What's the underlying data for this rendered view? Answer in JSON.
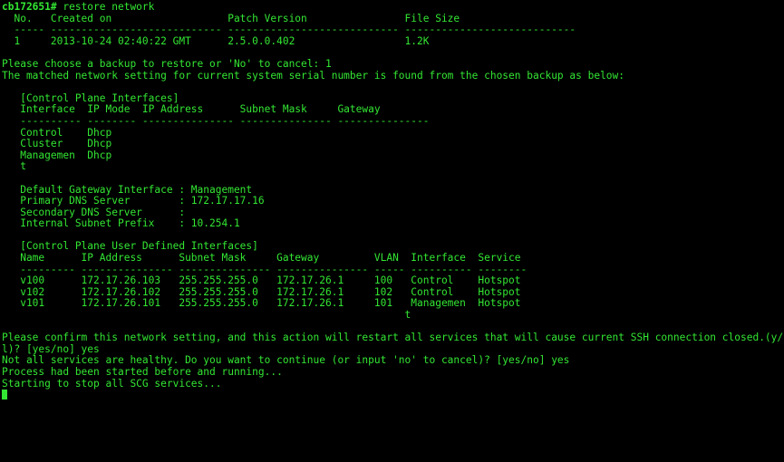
{
  "terminal": {
    "prompt": "cb172651#",
    "command": " restore network",
    "lines": [
      "  No.   Created on                   Patch Version                File Size",
      "  ----- ---------------------------- ---------------------------- ----------------------------",
      "  1     2013-10-24 02:40:22 GMT      2.5.0.0.402                  1.2K",
      "",
      "Please choose a backup to restore or 'No' to cancel: 1",
      "The matched network setting for current system serial number is found from the chosen backup as below:",
      "",
      "   [Control Plane Interfaces]",
      "   Interface  IP Mode  IP Address      Subnet Mask     Gateway",
      "   ---------- -------- --------------- --------------- ---------------",
      "   Control    Dhcp",
      "   Cluster    Dhcp",
      "   Managemen  Dhcp",
      "   t",
      "",
      "   Default Gateway Interface : Management",
      "   Primary DNS Server        : 172.17.17.16",
      "   Secondary DNS Server      :",
      "   Internal Subnet Prefix    : 10.254.1",
      "",
      "   [Control Plane User Defined Interfaces]",
      "   Name      IP Address      Subnet Mask     Gateway         VLAN  Interface  Service",
      "   --------- --------------- --------------- --------------- ----- ---------- --------",
      "   v100      172.17.26.103   255.255.255.0   172.17.26.1     100   Control    Hotspot",
      "   v102      172.17.26.102   255.255.255.0   172.17.26.1     102   Control    Hotspot",
      "   v101      172.17.26.101   255.255.255.0   172.17.26.1     101   Managemen  Hotspot",
      "                                                                  t",
      "",
      "Please confirm this network setting, and this action will restart all services that will cause current SSH connection closed.(y/n",
      "l)? [yes/no] yes",
      "Not all services are healthy. Do you want to continue (or input 'no' to cancel)? [yes/no] yes",
      "Process had been started before and running...",
      "Starting to stop all SCG services...",
      ""
    ]
  },
  "colors": {
    "background": "#000000",
    "text": "#33e633"
  }
}
